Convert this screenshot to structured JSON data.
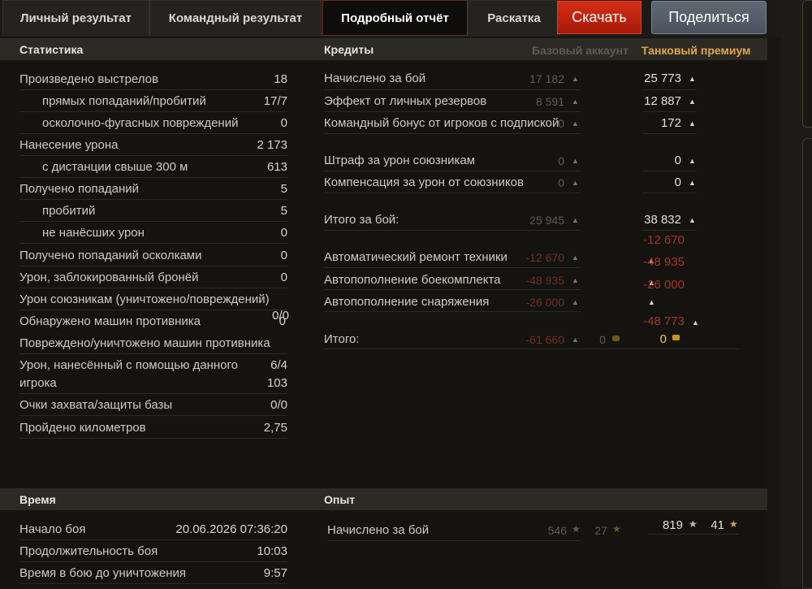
{
  "tabs": [
    {
      "label": "Личный результат"
    },
    {
      "label": "Командный результат"
    },
    {
      "label": "Подробный отчёт"
    },
    {
      "label": "Раскатка"
    }
  ],
  "actions": {
    "download": "Скачать",
    "share": "Поделиться"
  },
  "statistics": {
    "title": "Статистика",
    "rows": [
      {
        "label": "Произведено выстрелов",
        "value": "18"
      },
      {
        "label": "прямых попаданий/пробитий",
        "value": "17/7"
      },
      {
        "label": "осколочно-фугасных повреждений",
        "value": "0"
      },
      {
        "label": "Нанесение урона",
        "value": "2 173"
      },
      {
        "label": "с дистанции свыше 300 м",
        "value": "613"
      },
      {
        "label": "Получено попаданий",
        "value": "5"
      },
      {
        "label": "пробитий",
        "value": "5"
      },
      {
        "label": "не нанёсших урон",
        "value": "0"
      },
      {
        "label": "Получено попаданий осколками",
        "value": "0"
      },
      {
        "label": "Урон, заблокированный бронёй",
        "value": "0"
      },
      {
        "label": "Урон союзникам (уничтожено/повреждений)",
        "value": ""
      },
      {
        "label": "Обнаружено машин противника",
        "value": "0"
      },
      {
        "label": "Повреждено/уничтожено машин противника",
        "value": ""
      },
      {
        "label": "Урон, нанесённый с помощью данного",
        "value": "6/4"
      },
      {
        "label": "игрока",
        "value": "103"
      },
      {
        "label": "Очки захвата/защиты базы",
        "value": "0/0"
      },
      {
        "label": "Пройдено километров",
        "value": "2,75"
      }
    ],
    "extra_value": "0/0"
  },
  "credits": {
    "title": "Кредиты",
    "base_header": "Базовый аккаунт",
    "premium_header": "Танковый премиум",
    "rows": [
      {
        "label": "Начислено за бой",
        "base": "17 182",
        "premium": "25 773"
      },
      {
        "label": "Эффект от личных резервов",
        "base": "8 591",
        "premium": "12 887"
      },
      {
        "label": "Командный бонус от игроков с подпиской",
        "base": "0",
        "premium": "172"
      },
      {
        "label": "Штраф за урон союзникам",
        "base": "0",
        "premium": "0"
      },
      {
        "label": "Компенсация за урон от союзников",
        "base": "0",
        "premium": "0"
      },
      {
        "label": "Итого за бой:",
        "base": "25 945",
        "premium": "38 832"
      },
      {
        "label": "Автоматический ремонт техники",
        "base": "-12 670",
        "premium": "-12 670"
      },
      {
        "label": "Автопополнение боекомплекта",
        "base": "-48 935",
        "premium": "-48 935"
      },
      {
        "label": "Автопополнение снаряжения",
        "base": "-26 000",
        "premium": "-26 000"
      },
      {
        "label": "Итого:",
        "base": "-61 660",
        "base_gold": "0",
        "premium": "-48 773",
        "premium_gold": "0"
      }
    ]
  },
  "time": {
    "title": "Время",
    "rows": [
      {
        "label": "Начало боя",
        "value": "20.06.2026 07:36:20"
      },
      {
        "label": "Продолжительность боя",
        "value": "10:03"
      },
      {
        "label": "Время в бою до уничтожения",
        "value": "9:57"
      }
    ]
  },
  "experience": {
    "title": "Опыт",
    "rows": [
      {
        "label": "Начислено за бой",
        "base": "546",
        "base_free": "27",
        "premium": "819",
        "premium_free": "41"
      }
    ]
  },
  "colors": {
    "accent": "#e2a64a",
    "negative": "#a83427",
    "download": "#c8260f",
    "share": "#56606b"
  }
}
